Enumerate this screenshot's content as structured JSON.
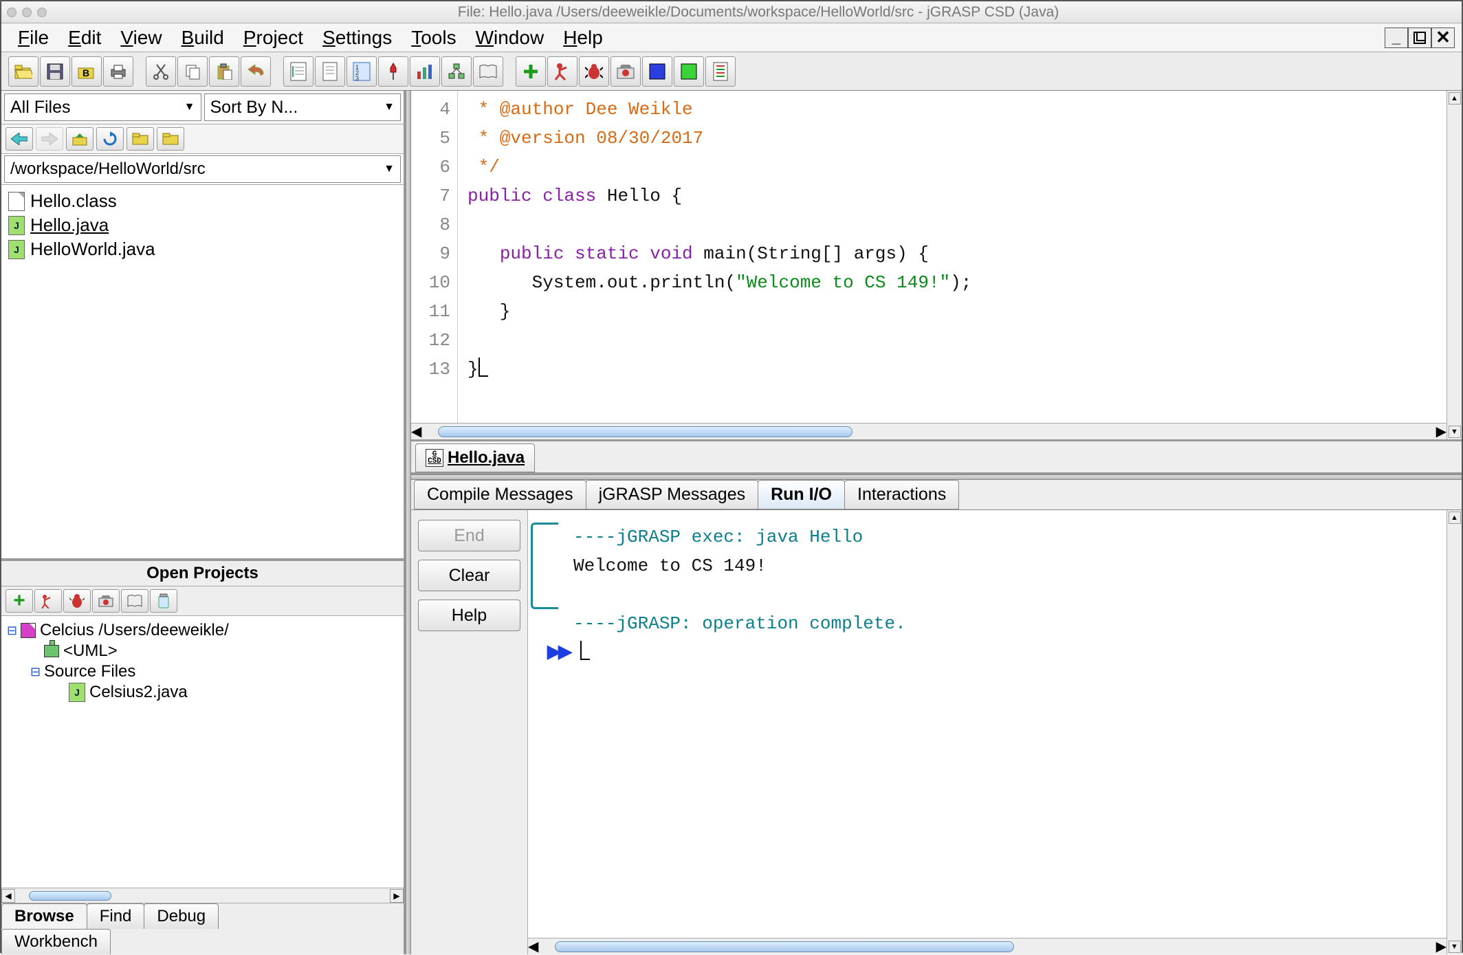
{
  "title": "File: Hello.java  /Users/deeweikle/Documents/workspace/HelloWorld/src - jGRASP CSD (Java)",
  "menu": [
    "File",
    "Edit",
    "View",
    "Build",
    "Project",
    "Settings",
    "Tools",
    "Window",
    "Help"
  ],
  "toolbar_icons": [
    "open",
    "save",
    "save-b",
    "print",
    "cut",
    "copy",
    "paste",
    "undo",
    "csd",
    "page",
    "line-num",
    "pin",
    "chart",
    "uml",
    "book",
    "plus",
    "runner",
    "bug",
    "camera",
    "blue-sq",
    "green-sq",
    "doc-lines"
  ],
  "left": {
    "filter": "All Files",
    "sort": "Sort By N...",
    "path": "/workspace/HelloWorld/src",
    "files": [
      {
        "name": "Hello.class",
        "icon": "plain",
        "active": false
      },
      {
        "name": "Hello.java",
        "icon": "java",
        "active": true
      },
      {
        "name": "HelloWorld.java",
        "icon": "java",
        "active": false
      }
    ],
    "projects_header": "Open Projects",
    "project_name": "Celcius   /Users/deeweikle/",
    "uml_label": "<UML>",
    "src_folder": "Source Files",
    "src_file": "Celsius2.java",
    "tabs_row1": [
      "Browse",
      "Find",
      "Debug"
    ],
    "tabs_row2": [
      "Workbench"
    ]
  },
  "editor": {
    "first_line": 4,
    "code_lines": [
      {
        "n": 4,
        "segments": [
          {
            "t": " * @author Dee Weikle",
            "c": "kw-comment"
          }
        ]
      },
      {
        "n": 5,
        "segments": [
          {
            "t": " * @version 08/30/2017",
            "c": "kw-comment"
          }
        ]
      },
      {
        "n": 6,
        "segments": [
          {
            "t": " */",
            "c": "kw-comment"
          }
        ]
      },
      {
        "n": 7,
        "segments": [
          {
            "t": "public class ",
            "c": "kw-purple"
          },
          {
            "t": "Hello {",
            "c": "kw-black"
          }
        ]
      },
      {
        "n": 8,
        "segments": []
      },
      {
        "n": 9,
        "segments": [
          {
            "t": "   ",
            "c": "kw-black"
          },
          {
            "t": "public static void ",
            "c": "kw-purple"
          },
          {
            "t": "main(String[] args) {",
            "c": "kw-black"
          }
        ]
      },
      {
        "n": 10,
        "segments": [
          {
            "t": "      System.out.println(",
            "c": "kw-black"
          },
          {
            "t": "\"Welcome to CS 149!\"",
            "c": "kw-green"
          },
          {
            "t": ");",
            "c": "kw-black"
          }
        ]
      },
      {
        "n": 11,
        "segments": [
          {
            "t": "   }",
            "c": "kw-black"
          }
        ]
      },
      {
        "n": 12,
        "segments": []
      },
      {
        "n": 13,
        "segments": [
          {
            "t": "}",
            "c": "kw-black"
          }
        ],
        "cursor": true
      }
    ],
    "tab": "Hello.java"
  },
  "message_tabs": [
    "Compile Messages",
    "jGRASP Messages",
    "Run I/O",
    "Interactions"
  ],
  "active_msg_tab": 2,
  "console": {
    "buttons": [
      "End",
      "Clear",
      "Help"
    ],
    "lines": [
      {
        "segments": [
          {
            "t": "   ----jGRASP exec: java Hello",
            "c": "c-teal"
          }
        ]
      },
      {
        "segments": [
          {
            "t": "   Welcome to CS 149!",
            "c": "c-blk"
          }
        ]
      },
      {
        "segments": [
          {
            "t": "",
            "c": "c-blk"
          }
        ]
      },
      {
        "segments": [
          {
            "t": "   ----jGRASP: operation complete.",
            "c": "c-teal"
          }
        ]
      }
    ],
    "prompt": "▶▶"
  }
}
